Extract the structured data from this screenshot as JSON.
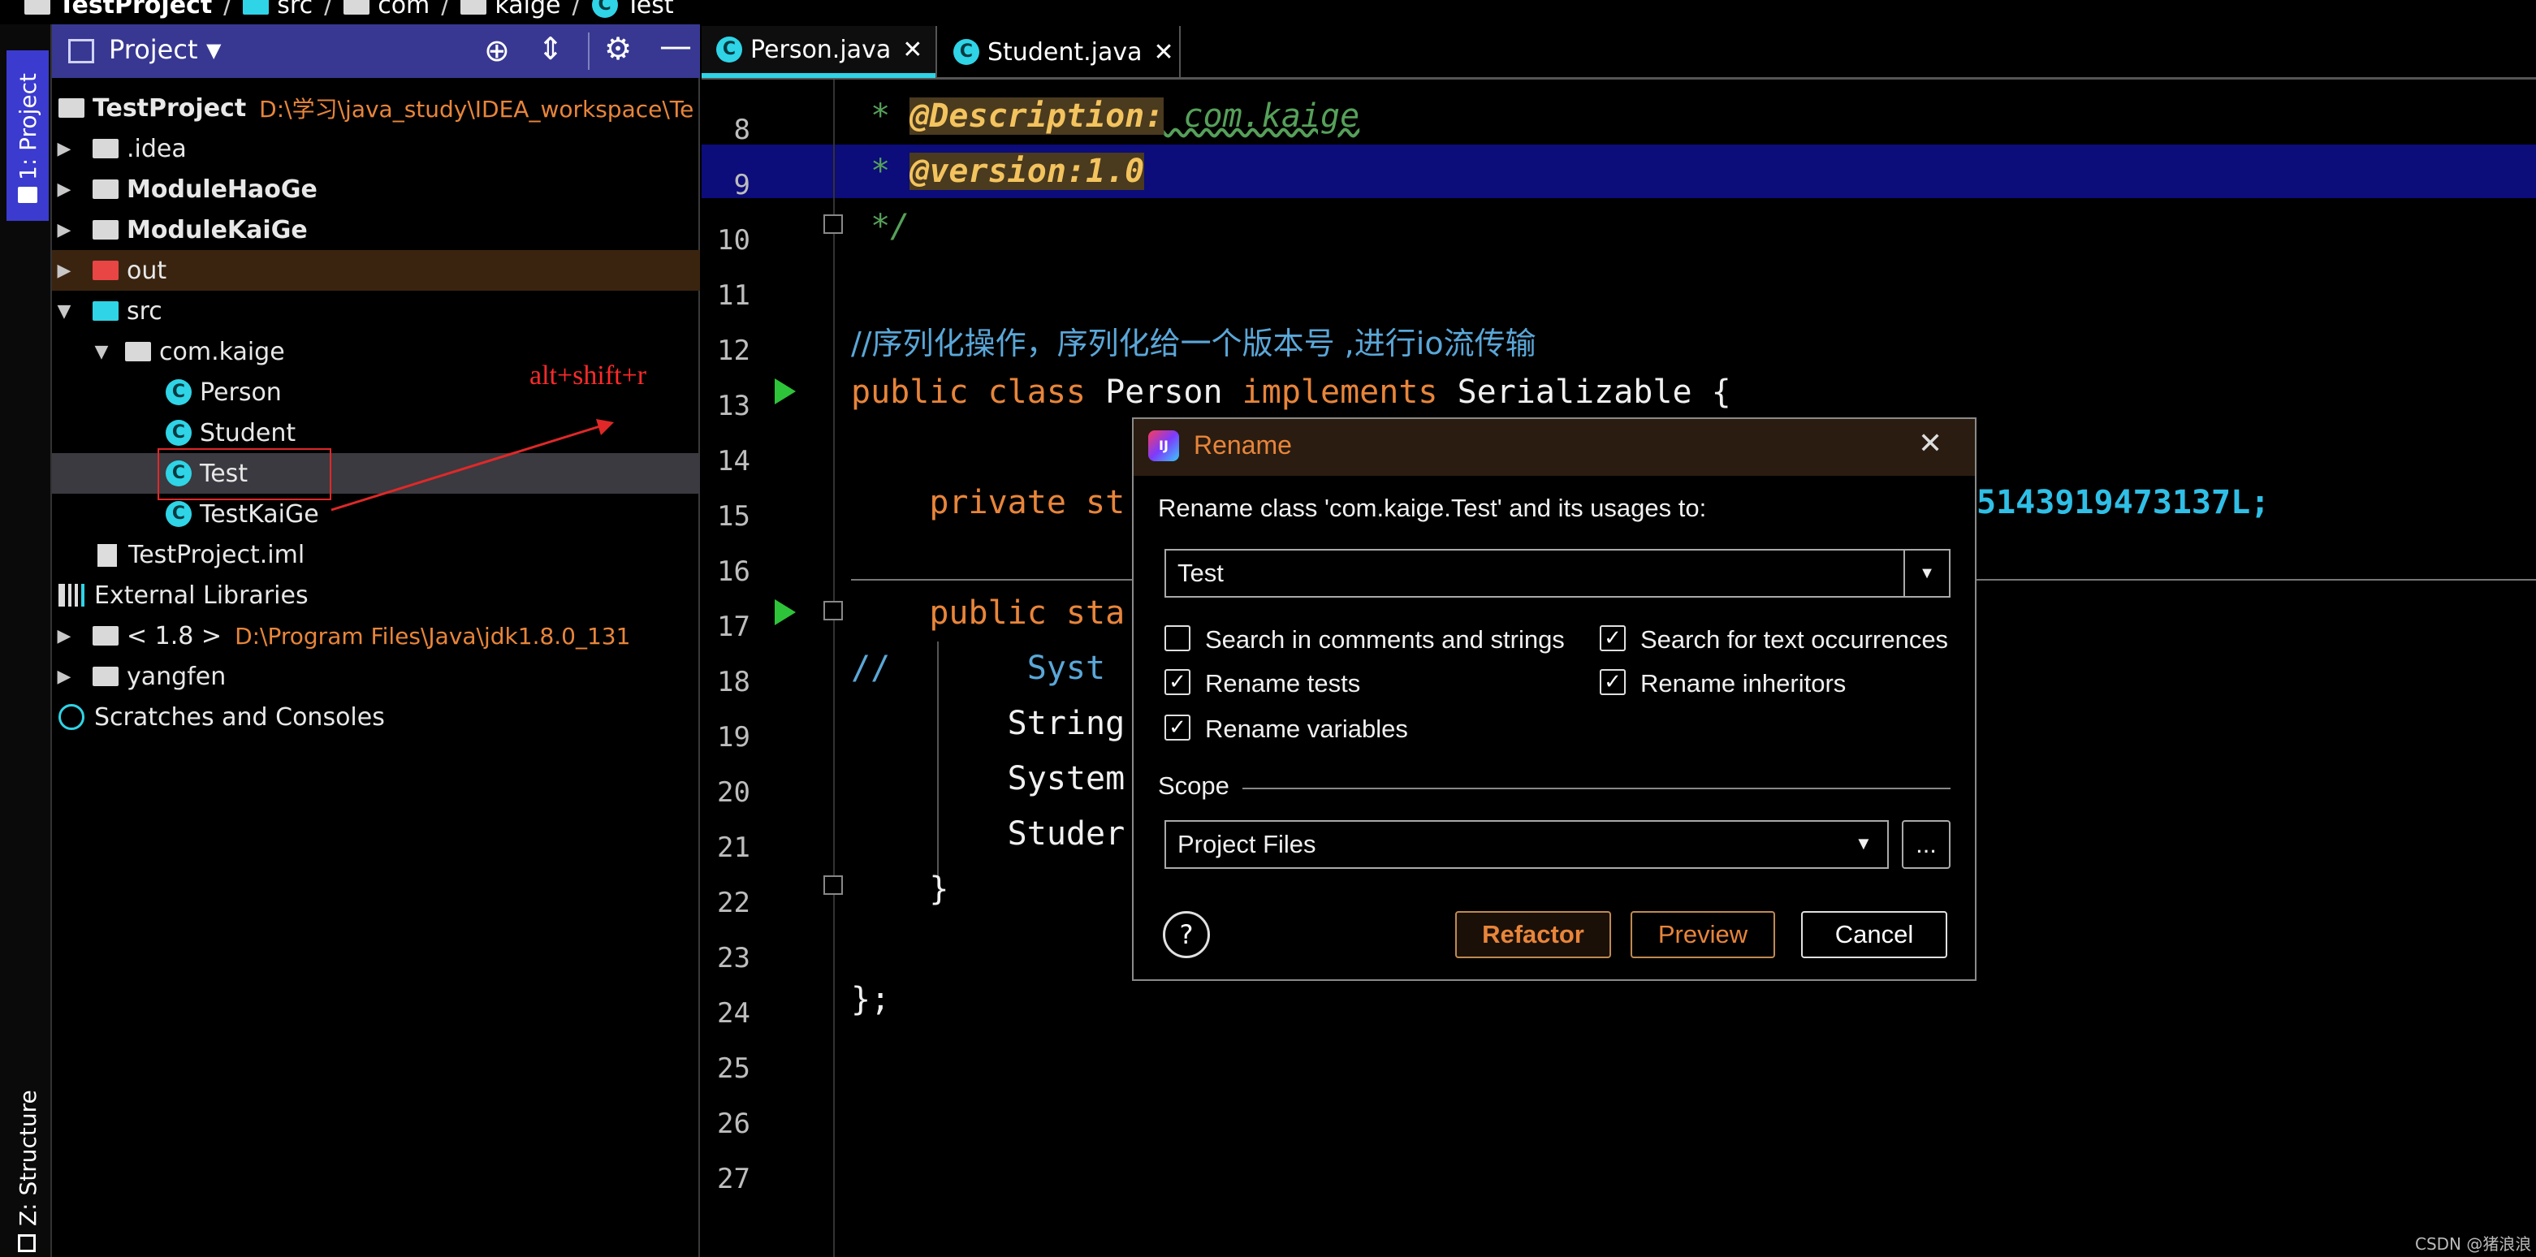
{
  "breadcrumb": [
    "TestProject",
    "src",
    "com",
    "kaige",
    "Test"
  ],
  "toolstrip": {
    "project_tab": "1: Project",
    "structure_tab": "Z: Structure"
  },
  "project_panel": {
    "title": "Project",
    "tree": [
      {
        "label": "TestProject",
        "path": "D:\\学习\\java_study\\IDEA_workspace\\Te"
      },
      {
        "label": ".idea"
      },
      {
        "label": "ModuleHaoGe"
      },
      {
        "label": "ModuleKaiGe"
      },
      {
        "label": "out"
      },
      {
        "label": "src"
      },
      {
        "label": "com.kaige"
      },
      {
        "label": "Person"
      },
      {
        "label": "Student"
      },
      {
        "label": "Test"
      },
      {
        "label": "TestKaiGe"
      },
      {
        "label": "TestProject.iml"
      },
      {
        "label": "External Libraries"
      },
      {
        "label": "< 1.8 >",
        "path": "D:\\Program Files\\Java\\jdk1.8.0_131"
      },
      {
        "label": "yangfen"
      },
      {
        "label": "Scratches and Consoles"
      }
    ]
  },
  "annotation": "alt+shift+r",
  "editor": {
    "tabs": [
      "Person.java",
      "Student.java"
    ],
    "line_numbers": [
      "8",
      "9",
      "10",
      "11",
      "12",
      "13",
      "14",
      "15",
      "16",
      "17",
      "18",
      "19",
      "20",
      "21",
      "22",
      "23",
      "24",
      "25",
      "26",
      "27"
    ],
    "lines": {
      "l8_star": " * ",
      "l8_tag": "@Description:",
      "l8_val": " com.kaige",
      "l9_star": " * ",
      "l9_tag": "@version:1.0",
      "l10": " */",
      "l12": "//序列化操作，序列化给一个版本号 ,进行io流传输",
      "l13_kw": "public class ",
      "l13_name": "Person ",
      "l13_kw2": "implements ",
      "l13_rest": "Serializable {",
      "l15_kw": "    private st",
      "l15_tail": "5143919473137L;",
      "l17_kw": "    public sta",
      "l18_c": "//       Syst",
      "l19": "        String",
      "l20": "        System",
      "l21": "        Studer",
      "l22": "    }",
      "l24": "};"
    }
  },
  "dialog": {
    "title": "Rename",
    "prompt": "Rename class 'com.kaige.Test' and its usages to:",
    "name_value": "Test",
    "options": [
      {
        "label": "Search in comments and strings",
        "checked": false
      },
      {
        "label": "Search for text occurrences",
        "checked": true
      },
      {
        "label": "Rename tests",
        "checked": true
      },
      {
        "label": "Rename inheritors",
        "checked": true
      },
      {
        "label": "Rename variables",
        "checked": true
      }
    ],
    "scope_label": "Scope",
    "scope_value": "Project Files",
    "browse": "...",
    "help": "?",
    "refactor": "Refactor",
    "preview": "Preview",
    "cancel": "Cancel"
  },
  "watermark": "CSDN @猪浪浪"
}
